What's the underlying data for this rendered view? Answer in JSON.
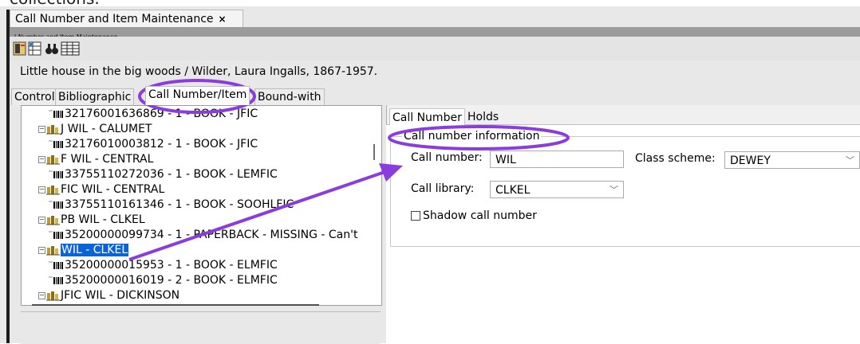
{
  "app": {
    "top_caption": "collections.",
    "document_tab": "Call Number and Item Maintenance",
    "document_tab_close": "×",
    "window_title": "l Number and Item Maintenance",
    "title_info": "Little house in the big woods / Wilder, Laura Ingalls, 1867-1957."
  },
  "toolbar": {
    "icons": [
      "record-icon",
      "spreadsheet-icon",
      "binoculars-icon",
      "grid-icon"
    ]
  },
  "tabs": [
    {
      "label": "Control",
      "active": false
    },
    {
      "label": "Bibliographic",
      "active": false
    },
    {
      "label": "Call Number/Item",
      "active": true
    },
    {
      "label": "Bound-with",
      "active": false
    }
  ],
  "tree": {
    "lines": [
      {
        "kind": "item",
        "text": "32176001636869 - 1 - BOOK - JFIC"
      },
      {
        "kind": "call",
        "text": "J WIL - CALUMET"
      },
      {
        "kind": "item",
        "text": "32176010003812 - 1 - BOOK - JFIC"
      },
      {
        "kind": "call",
        "text": "F WIL - CENTRAL"
      },
      {
        "kind": "item",
        "text": "33755110272036 - 1 - BOOK - LEMFIC"
      },
      {
        "kind": "call",
        "text": "FIC WIL - CENTRAL"
      },
      {
        "kind": "item",
        "text": "33755110161346 - 1 - BOOK - SOOHLFIC"
      },
      {
        "kind": "call",
        "text": "PB WIL - CLKEL"
      },
      {
        "kind": "item",
        "text": "35200000099734 - 1 - PAPERBACK - MISSING - Can't"
      },
      {
        "kind": "call",
        "text": "WIL - CLKEL",
        "selected": true
      },
      {
        "kind": "item",
        "text": "35200000015953 - 1 - BOOK - ELMFIC"
      },
      {
        "kind": "item",
        "text": "35200000016019 - 2 - BOOK - ELMFIC"
      },
      {
        "kind": "call",
        "text": "JFIC WIL - DICKINSON"
      }
    ]
  },
  "right": {
    "tabs": [
      {
        "label": "Call Number",
        "active": true
      },
      {
        "label": "Holds",
        "active": false
      }
    ],
    "group_title": "Call number information",
    "call_number_label": "Call number:",
    "call_number_value": "WIL",
    "class_scheme_label": "Class scheme:",
    "class_scheme_value": "DEWEY",
    "call_library_label": "Call library:",
    "call_library_value": "CLKEL",
    "shadow_label": "Shadow call number",
    "shadow_checked": false
  },
  "colors": {
    "annotation": "#8a3ddc",
    "selection": "#0a64d8"
  }
}
